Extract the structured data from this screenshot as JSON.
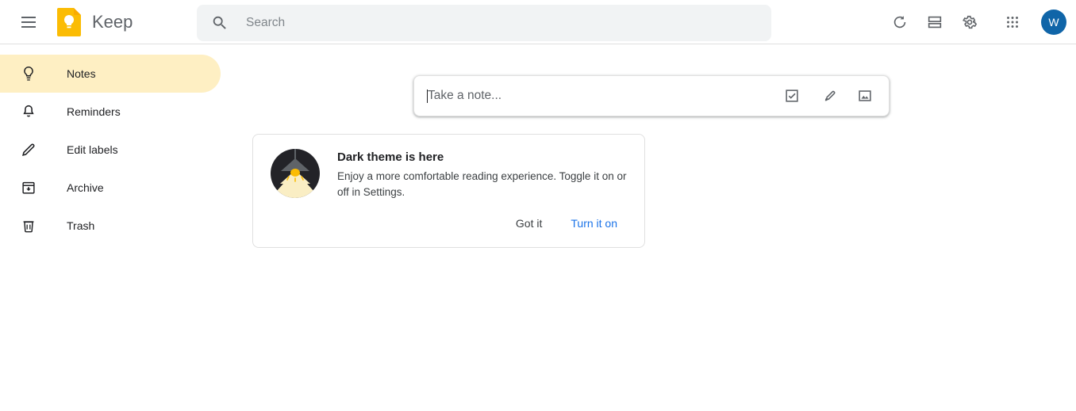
{
  "header": {
    "menu_icon": "hamburger-menu-icon",
    "app_name": "Keep",
    "logo_icon": "keep-lightbulb-logo",
    "search": {
      "icon": "search-icon",
      "placeholder": "Search",
      "value": ""
    },
    "actions": [
      {
        "icon": "refresh-icon",
        "label": "Refresh"
      },
      {
        "icon": "list-view-icon",
        "label": "List view"
      },
      {
        "icon": "settings-gear-icon",
        "label": "Settings"
      },
      {
        "icon": "apps-grid-icon",
        "label": "Google apps"
      }
    ],
    "avatar": {
      "initial": "W",
      "color": "#1065a8"
    }
  },
  "sidebar": {
    "items": [
      {
        "label": "Notes",
        "icon": "lightbulb-icon",
        "active": true
      },
      {
        "label": "Reminders",
        "icon": "bell-icon",
        "active": false
      },
      {
        "label": "Edit labels",
        "icon": "pencil-icon",
        "active": false
      },
      {
        "label": "Archive",
        "icon": "archive-box-icon",
        "active": false
      },
      {
        "label": "Trash",
        "icon": "trash-can-icon",
        "active": false
      }
    ],
    "active_color": "#feefc3"
  },
  "main": {
    "note_input": {
      "placeholder": "Take a note...",
      "actions": [
        {
          "icon": "new-list-checkbox-icon",
          "label": "New list"
        },
        {
          "icon": "paintbrush-icon",
          "label": "New note with drawing"
        },
        {
          "icon": "image-icon",
          "label": "New note with image"
        }
      ]
    },
    "theme_card": {
      "illustration": "dark-theme-lamp-illustration",
      "title": "Dark theme is here",
      "body": "Enjoy a more comfortable reading experience. Toggle it on or off in Settings.",
      "dismiss_label": "Got it",
      "confirm_label": "Turn it on",
      "confirm_color": "#1a73e8"
    }
  }
}
